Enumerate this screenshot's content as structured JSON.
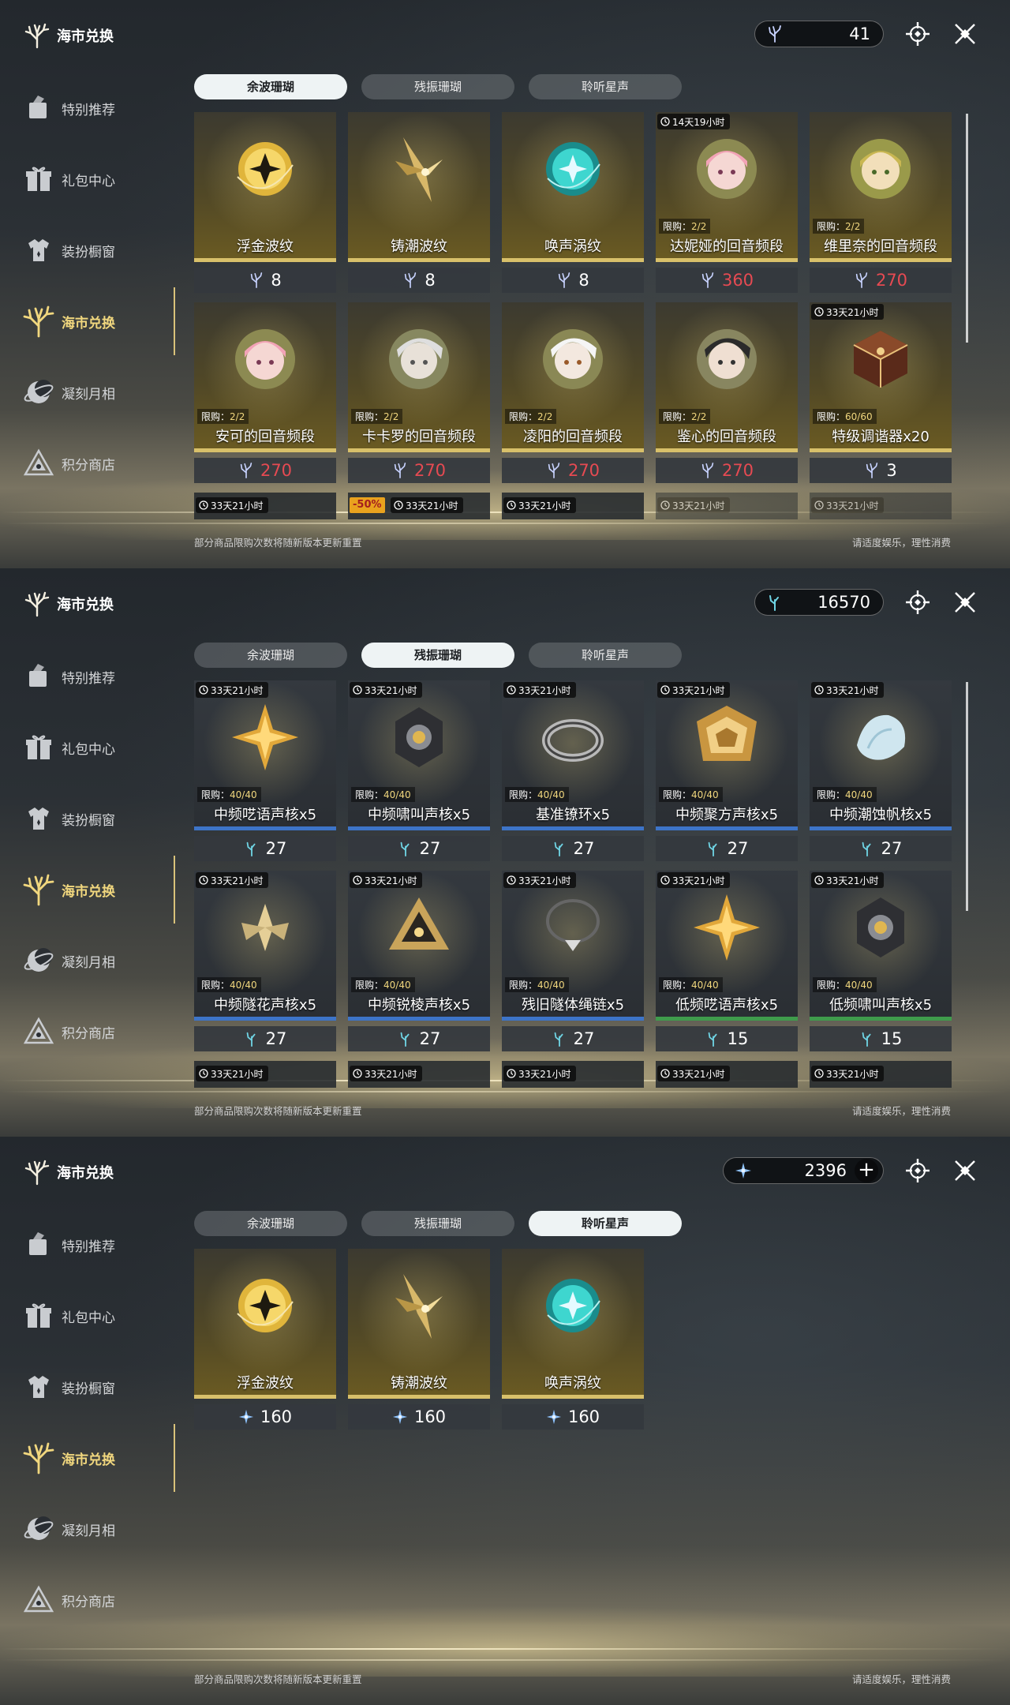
{
  "colors": {
    "accent_gold": "#f1d77e",
    "price_red": "#e64a52",
    "tab_active_bg": "#eef3f4",
    "discount_bg": "#e9a21e"
  },
  "sidebar": {
    "title": "海市兑换",
    "items": [
      {
        "label": "特别推荐",
        "icon": "featured-icon"
      },
      {
        "label": "礼包中心",
        "icon": "gift-icon"
      },
      {
        "label": "装扮橱窗",
        "icon": "wardrobe-icon"
      },
      {
        "label": "海市兑换",
        "icon": "coral-icon"
      },
      {
        "label": "凝刻月相",
        "icon": "moon-icon"
      },
      {
        "label": "积分商店",
        "icon": "points-icon"
      }
    ]
  },
  "tabs": [
    "余波珊瑚",
    "残振珊瑚",
    "聆听星声"
  ],
  "footer": {
    "note": "部分商品限购次数将随新版本更新重置",
    "advice": "请适度娱乐，理性消费"
  },
  "panels": [
    {
      "active_tab": 0,
      "currency": {
        "amount": "41",
        "icon": "afterglow-coral-icon",
        "has_plus": false
      },
      "items": [
        {
          "name": "浮金波纹",
          "art": "gold-orb-icon",
          "price": "8"
        },
        {
          "name": "铸潮波纹",
          "art": "star-blade-icon",
          "price": "8"
        },
        {
          "name": "唤声涡纹",
          "art": "teal-orb-icon",
          "price": "8"
        },
        {
          "name": "达妮娅的回音频段",
          "art": "portrait-pink-icon",
          "price": "360",
          "red": true,
          "timer": "14天19小时",
          "limit_label": "限购：",
          "limit": "2/2"
        },
        {
          "name": "维里奈的回音频段",
          "art": "portrait-green-icon",
          "price": "270",
          "red": true,
          "limit_label": "限购：",
          "limit": "2/2"
        },
        {
          "name": "安可的回音频段",
          "art": "portrait-pink-icon",
          "price": "270",
          "red": true,
          "limit_label": "限购：",
          "limit": "2/2"
        },
        {
          "name": "卡卡罗的回音频段",
          "art": "portrait-silver-icon",
          "price": "270",
          "red": true,
          "limit_label": "限购：",
          "limit": "2/2"
        },
        {
          "name": "凌阳的回音频段",
          "art": "portrait-white-icon",
          "price": "270",
          "red": true,
          "limit_label": "限购：",
          "limit": "2/2"
        },
        {
          "name": "鉴心的回音频段",
          "art": "portrait-dark-icon",
          "price": "270",
          "red": true,
          "limit_label": "限购：",
          "limit": "2/2"
        },
        {
          "name": "特级调谐器x20",
          "art": "tuner-box-icon",
          "price": "3",
          "timer": "33天21小时",
          "limit_label": "限购：",
          "limit": "60/60"
        }
      ],
      "next_row": [
        {
          "timer": "33天21小时"
        },
        {
          "timer": "33天21小时",
          "discount": "-50%"
        },
        {
          "timer": "33天21小时"
        },
        {
          "timer": "33天21小时",
          "dim": true
        },
        {
          "timer": "33天21小时",
          "dim": true
        }
      ]
    },
    {
      "active_tab": 1,
      "currency": {
        "amount": "16570",
        "icon": "oscillated-coral-icon",
        "has_plus": false
      },
      "items": [
        {
          "name": "中频呓语声核x5",
          "art": "gold-star-icon",
          "price": "27",
          "timer": "33天21小时",
          "limit_label": "限购：",
          "limit": "40/40",
          "bar": "blue"
        },
        {
          "name": "中频啸叫声核x5",
          "art": "dark-core-icon",
          "price": "27",
          "timer": "33天21小时",
          "limit_label": "限购：",
          "limit": "40/40",
          "bar": "blue"
        },
        {
          "name": "基准镣环x5",
          "art": "ring-icon",
          "price": "27",
          "timer": "33天21小时",
          "limit_label": "限购：",
          "limit": "40/40",
          "bar": "blue"
        },
        {
          "name": "中频聚方声核x5",
          "art": "gold-prism-icon",
          "price": "27",
          "timer": "33天21小时",
          "limit_label": "限购：",
          "limit": "40/40",
          "bar": "blue"
        },
        {
          "name": "中频潮蚀帆核x5",
          "art": "shell-icon",
          "price": "27",
          "timer": "33天21小时",
          "limit_label": "限购：",
          "limit": "40/40",
          "bar": "blue"
        },
        {
          "name": "中频隧花声核x5",
          "art": "crystal-flower-icon",
          "price": "27",
          "timer": "33天21小时",
          "limit_label": "限购：",
          "limit": "40/40",
          "bar": "blue"
        },
        {
          "name": "中频锐棱声核x5",
          "art": "triangle-core-icon",
          "price": "27",
          "timer": "33天21小时",
          "limit_label": "限购：",
          "limit": "40/40",
          "bar": "blue"
        },
        {
          "name": "残旧隧体绳链x5",
          "art": "necklace-icon",
          "price": "27",
          "timer": "33天21小时",
          "limit_label": "限购：",
          "limit": "40/40",
          "bar": "blue"
        },
        {
          "name": "低频呓语声核x5",
          "art": "gold-star-icon",
          "price": "15",
          "timer": "33天21小时",
          "limit_label": "限购：",
          "limit": "40/40",
          "bar": "green"
        },
        {
          "name": "低频啸叫声核x5",
          "art": "dark-core-icon",
          "price": "15",
          "timer": "33天21小时",
          "limit_label": "限购：",
          "limit": "40/40",
          "bar": "green"
        }
      ],
      "next_row": [
        {
          "timer": "33天21小时"
        },
        {
          "timer": "33天21小时"
        },
        {
          "timer": "33天21小时"
        },
        {
          "timer": "33天21小时"
        },
        {
          "timer": "33天21小时"
        }
      ]
    },
    {
      "active_tab": 2,
      "currency": {
        "amount": "2396",
        "icon": "starsound-icon",
        "has_plus": true,
        "plus_label": "+"
      },
      "items": [
        {
          "name": "浮金波纹",
          "art": "gold-orb-icon",
          "price": "160"
        },
        {
          "name": "铸潮波纹",
          "art": "star-blade-icon",
          "price": "160"
        },
        {
          "name": "唤声涡纹",
          "art": "teal-orb-icon",
          "price": "160"
        }
      ],
      "next_row": []
    }
  ]
}
